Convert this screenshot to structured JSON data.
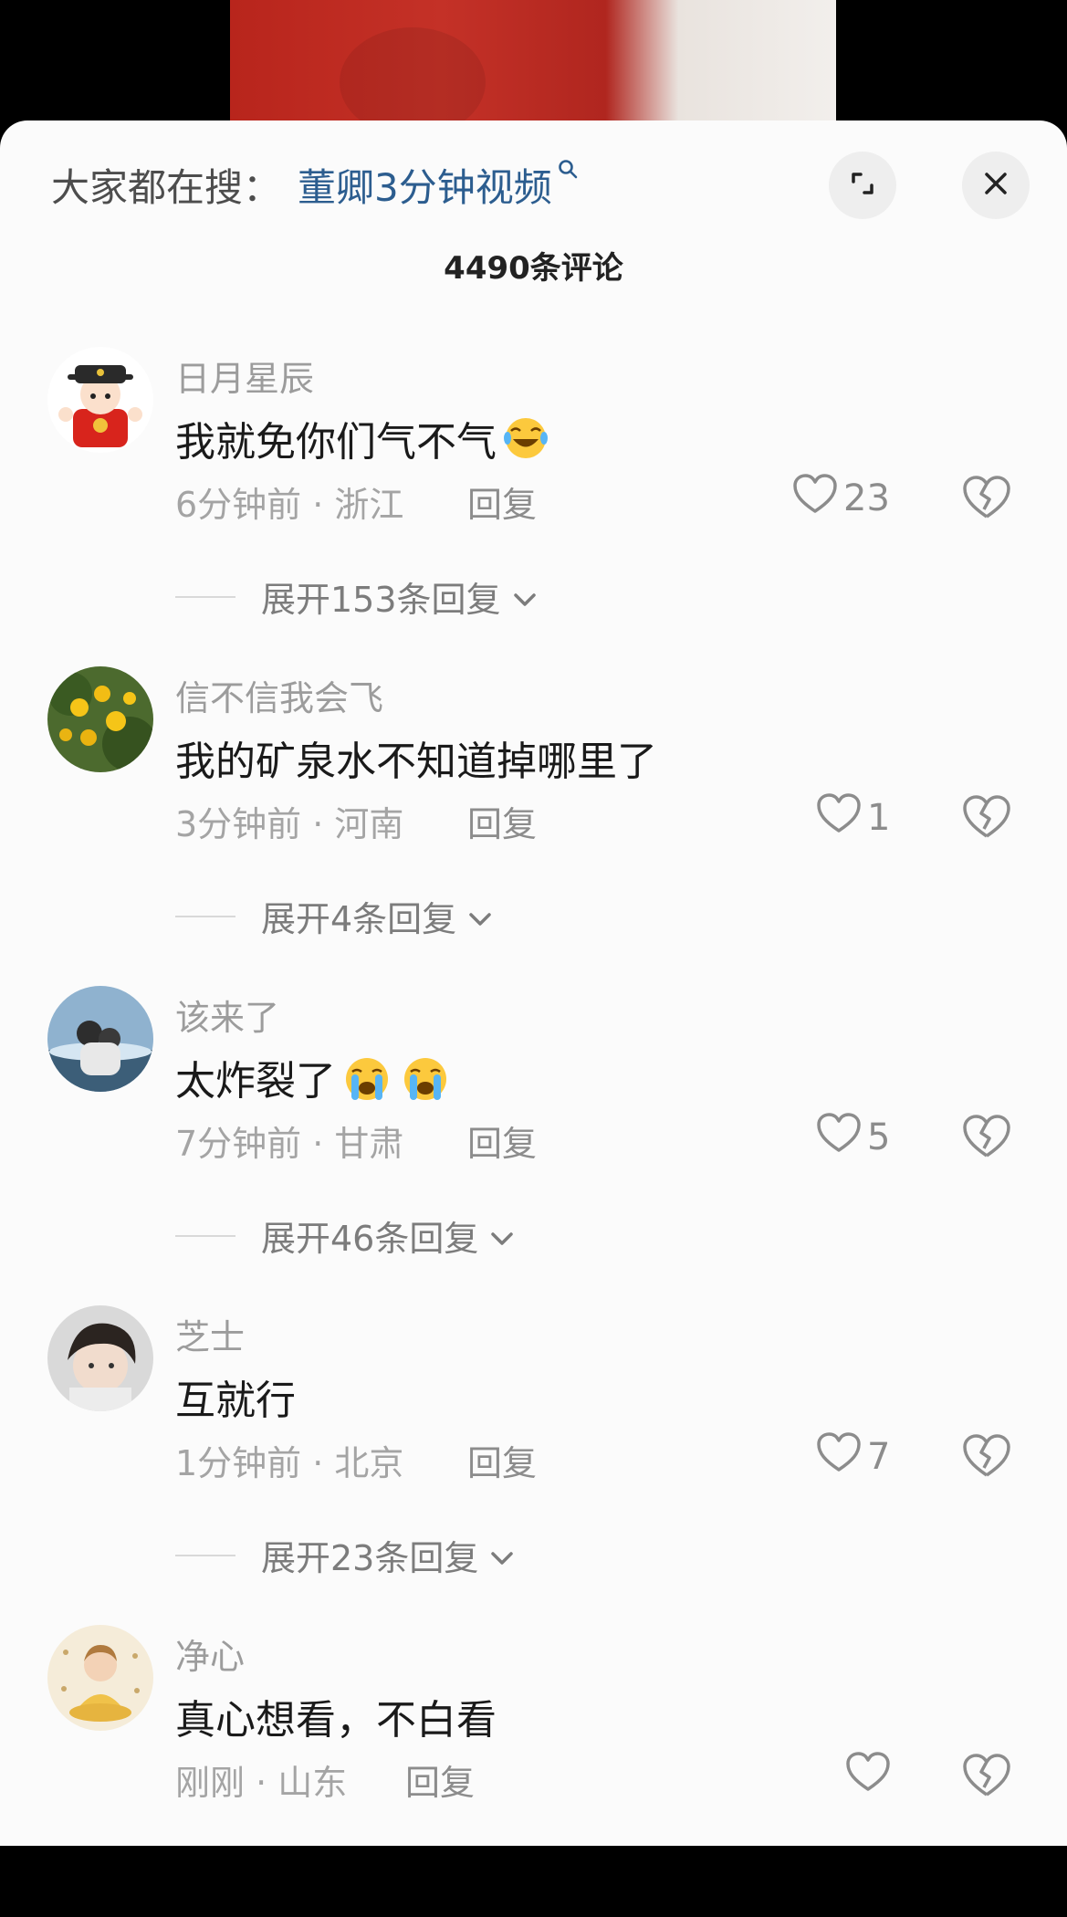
{
  "header": {
    "search_prefix": "大家都在搜：",
    "search_term": "董卿3分钟视频",
    "comment_count": "4490条评论",
    "expand_icon": "expand-icon",
    "close_icon": "close-icon"
  },
  "video": {
    "watermark": ""
  },
  "comments": [
    {
      "username": "日月星辰",
      "text": "我就免你们气不气",
      "emojis": [
        "laugh-cry"
      ],
      "time": "6分钟前 · 浙江",
      "reply": "回复",
      "likes": "23",
      "expand": "展开153条回复"
    },
    {
      "username": "信不信我会飞",
      "text": "我的矿泉水不知道掉哪里了",
      "emojis": [],
      "time": "3分钟前 · 河南",
      "reply": "回复",
      "likes": "1",
      "expand": "展开4条回复"
    },
    {
      "username": "该来了",
      "text": "太炸裂了",
      "emojis": [
        "loudly-crying",
        "loudly-crying"
      ],
      "time": "7分钟前 · 甘肃",
      "reply": "回复",
      "likes": "5",
      "expand": "展开46条回复"
    },
    {
      "username": "芝士",
      "text": "互就行",
      "emojis": [],
      "time": "1分钟前 · 北京",
      "reply": "回复",
      "likes": "7",
      "expand": "展开23条回复"
    },
    {
      "username": "净心",
      "text": "真心想看，不白看",
      "emojis": [],
      "time": "刚刚 · 山东",
      "reply": "回复",
      "likes": "",
      "expand": ""
    }
  ],
  "colors": {
    "link": "#2c5d8f",
    "meta": "#a4a4a4",
    "sheet": "#fbfbfb"
  }
}
